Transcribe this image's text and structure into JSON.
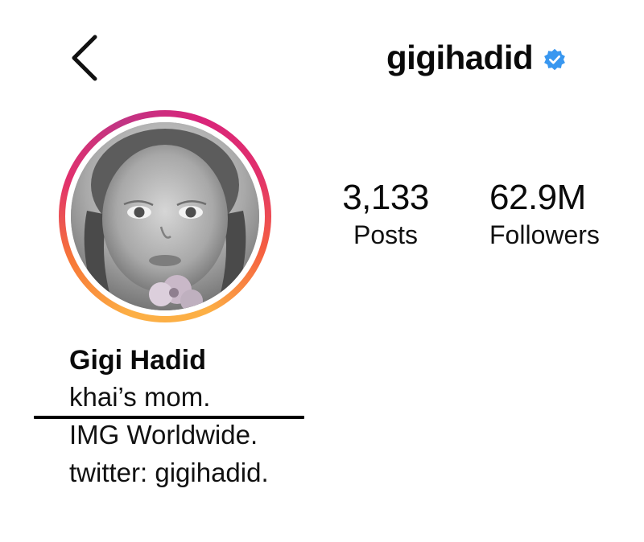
{
  "header": {
    "back_icon": "chevron-left-icon",
    "username": "gigihadid",
    "verified_icon": "verified-badge-icon",
    "verified_color": "#3897f0"
  },
  "profile": {
    "avatar_ring_colors": [
      "#d9247a",
      "#f56040",
      "#fcaf45"
    ],
    "stats": {
      "posts_value": "3,133",
      "posts_label": "Posts",
      "followers_value": "62.9M",
      "followers_label": "Followers"
    },
    "display_name": "Gigi Hadid",
    "bio_lines": [
      "khai’s mom.",
      "IMG Worldwide.",
      "twitter: gigihadid."
    ]
  }
}
